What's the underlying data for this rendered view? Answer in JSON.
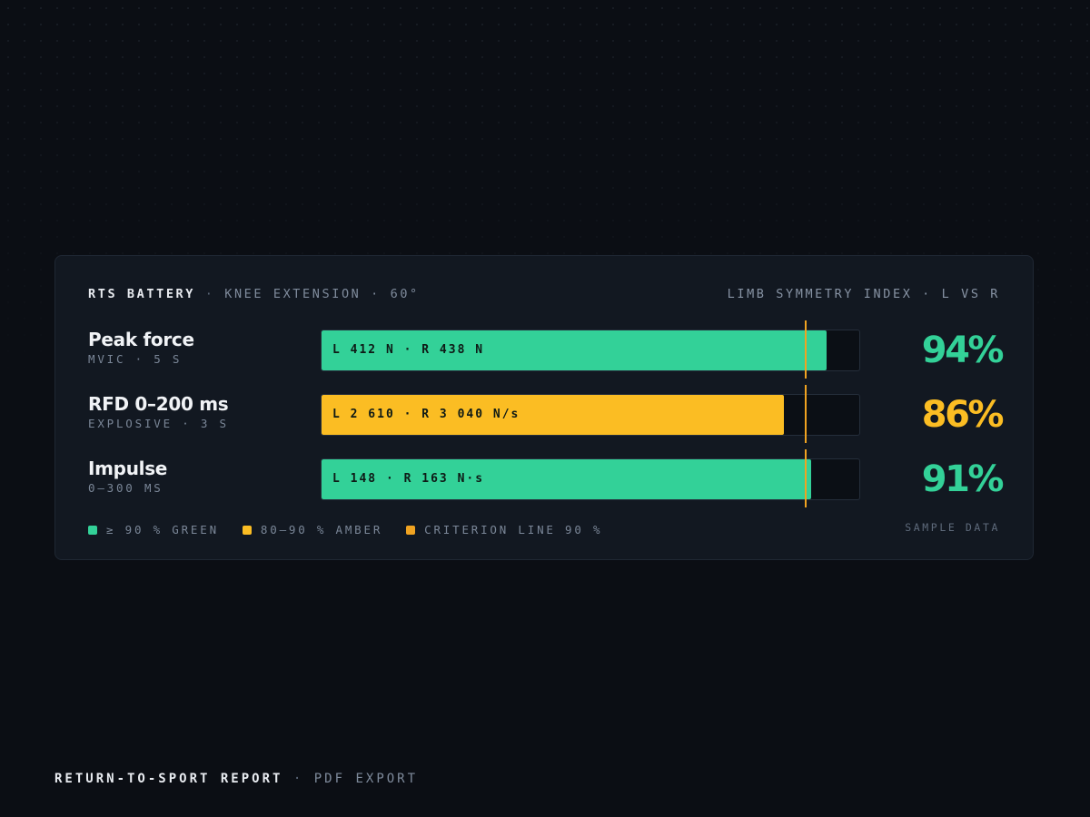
{
  "header": {
    "title": "RTS BATTERY",
    "context": "KNEE EXTENSION · 60°",
    "separator": "·",
    "right_label": "LIMB SYMMETRY INDEX · L VS R"
  },
  "colors": {
    "green": "#33d198",
    "amber": "#fbbd23",
    "criterion": "#f0a321",
    "background": "#0b0e14",
    "panel": "#121821"
  },
  "chart_data": {
    "type": "bar",
    "orientation": "horizontal",
    "criterion": 90,
    "xlim": [
      0,
      100
    ],
    "categories": [
      "Peak force",
      "RFD 0–200 ms",
      "Impulse"
    ],
    "values": [
      94,
      86,
      91
    ],
    "rows": [
      {
        "name": "Peak force",
        "sub": "MVIC · 5 S",
        "detail": "L 412 N · R 438 N",
        "left": 412,
        "right": 438,
        "unit": "N",
        "lsi": 94,
        "lsi_label": "94%",
        "status": "green"
      },
      {
        "name": "RFD 0–200 ms",
        "sub": "EXPLOSIVE · 3 S",
        "detail": "L 2 610 · R 3 040 N/s",
        "left": 2610,
        "right": 3040,
        "unit": "N/s",
        "lsi": 86,
        "lsi_label": "86%",
        "status": "amber"
      },
      {
        "name": "Impulse",
        "sub": "0–300 MS",
        "detail": "L 148 · R 163 N·s",
        "left": 148,
        "right": 163,
        "unit": "N·s",
        "lsi": 91,
        "lsi_label": "91%",
        "status": "green"
      }
    ],
    "legend": [
      {
        "label": "≥ 90 % GREEN",
        "color": "#33d198"
      },
      {
        "label": "80–90 % AMBER",
        "color": "#fbbd23"
      },
      {
        "label": "CRITERION LINE 90 %",
        "color": "#f0a321"
      }
    ],
    "note": "SAMPLE DATA"
  },
  "footer": {
    "title": "RETURN-TO-SPORT REPORT",
    "separator": "·",
    "action": "PDF EXPORT"
  }
}
